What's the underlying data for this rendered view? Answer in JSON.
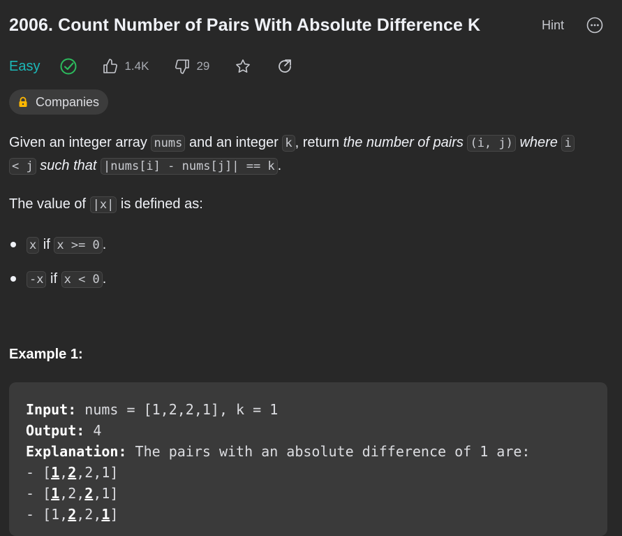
{
  "problem": {
    "title": "2006. Count Number of Pairs With Absolute Difference K",
    "hint_label": "Hint",
    "difficulty": "Easy",
    "likes": "1.4K",
    "dislikes": "29",
    "companies_label": "Companies"
  },
  "description": {
    "p1": [
      "Given an integer array ",
      "nums",
      " and an integer ",
      "k",
      ", return ",
      "the number of pairs",
      " ",
      "(i, j)",
      " ",
      "where",
      " ",
      "i",
      "< j",
      " ",
      "such that",
      " ",
      "|nums[i] - nums[j]| == k",
      "."
    ],
    "p2": [
      "The value of ",
      "|x|",
      " is defined as:"
    ],
    "bullets": [
      [
        "x",
        " if ",
        "x >= 0",
        "."
      ],
      [
        "-x",
        " if ",
        "x < 0",
        "."
      ]
    ]
  },
  "example": {
    "title": "Example 1:",
    "input_label": "Input:",
    "input_value": " nums = [1,2,2,1], k = 1",
    "output_label": "Output:",
    "output_value": " 4",
    "explanation_label": "Explanation:",
    "explanation_value": " The pairs with an absolute difference of 1 are:",
    "pairs": [
      [
        "- [",
        "1",
        ",",
        "2",
        ",2,1]"
      ],
      [
        "- [",
        "1",
        ",2,",
        "2",
        ",1]"
      ],
      [
        "- [1,",
        "2",
        ",2,",
        "1",
        "]"
      ]
    ]
  },
  "colors": {
    "background": "#282828",
    "difficulty_easy": "#1cb8b8",
    "solved_check": "#2cbb5d"
  },
  "icons": [
    "more-horizontal-icon",
    "solved-check-icon",
    "thumbs-up-icon",
    "thumbs-down-icon",
    "star-icon",
    "share-icon",
    "lock-icon"
  ]
}
